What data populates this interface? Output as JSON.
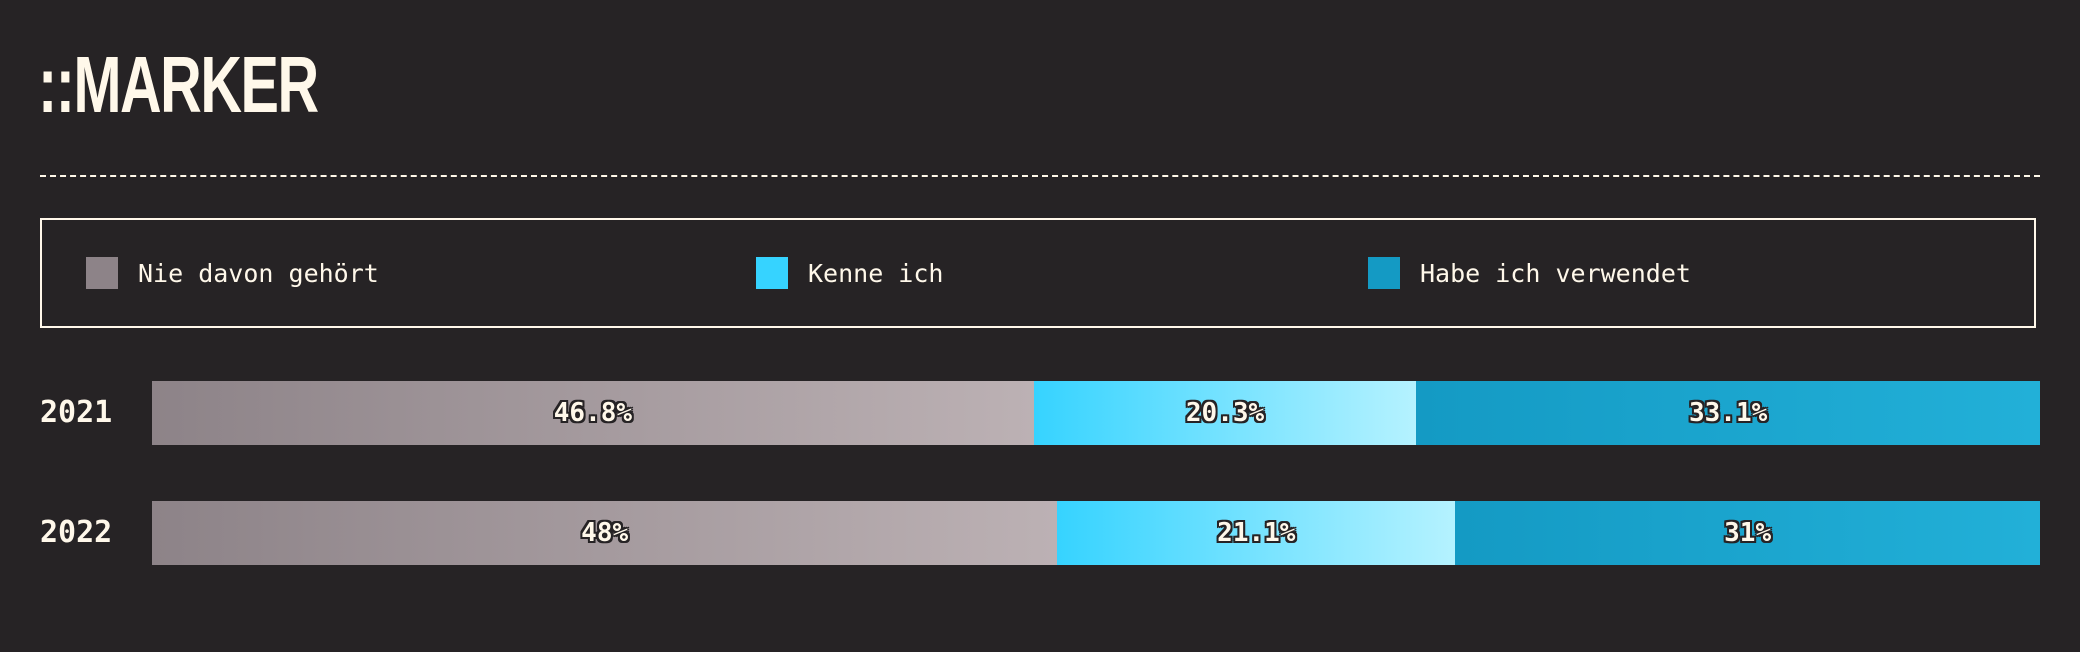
{
  "header": {
    "title": "::MARKER"
  },
  "colors": {
    "background": "#262325",
    "text": "#fff8ea",
    "never_heard_start": "#8d8388",
    "never_heard_end": "#bcb1b4",
    "know_it_start": "#36d3ff",
    "know_it_end": "#b5f2ff",
    "used_it_start": "#149ac4",
    "used_it_end": "#22b0d8"
  },
  "chart_data": {
    "type": "bar",
    "stacked": true,
    "orientation": "horizontal",
    "normalized": true,
    "categories": [
      "2021",
      "2022"
    ],
    "series": [
      {
        "name": "Nie davon gehört",
        "values": [
          46.8,
          48
        ],
        "labels": [
          "46.8%",
          "48%"
        ],
        "color": "#8d8388",
        "color_end": "#bcb1b4"
      },
      {
        "name": "Kenne ich",
        "values": [
          20.3,
          21.1
        ],
        "labels": [
          "20.3%",
          "21.1%"
        ],
        "color": "#36d3ff",
        "color_end": "#b5f2ff"
      },
      {
        "name": "Habe ich verwendet",
        "values": [
          33.1,
          31
        ],
        "labels": [
          "33.1%",
          "31%"
        ],
        "color": "#149ac4",
        "color_end": "#22b0d8"
      }
    ],
    "xlim": [
      0,
      100
    ],
    "grid": false,
    "legend": "top"
  }
}
